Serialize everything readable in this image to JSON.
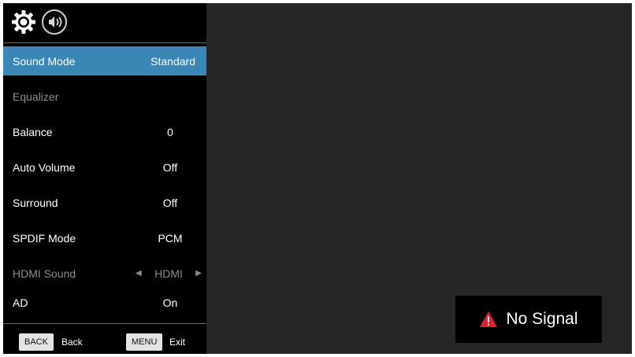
{
  "header": {
    "icons": [
      "gear-icon",
      "speaker-icon"
    ]
  },
  "menu": {
    "items": [
      {
        "label": "Sound Mode",
        "value": "Standard",
        "state": "selected"
      },
      {
        "label": "Equalizer",
        "value": "",
        "state": "disabled"
      },
      {
        "label": "Balance",
        "value": "0",
        "state": "normal"
      },
      {
        "label": "Auto Volume",
        "value": "Off",
        "state": "normal"
      },
      {
        "label": "Surround",
        "value": "Off",
        "state": "normal"
      },
      {
        "label": "SPDIF Mode",
        "value": "PCM",
        "state": "normal"
      },
      {
        "label": "HDMI Sound",
        "value": "HDMI",
        "state": "disabled"
      },
      {
        "label": "AD",
        "value": "On",
        "state": "normal"
      }
    ]
  },
  "footer": {
    "back_key": "BACK",
    "back_label": "Back",
    "menu_key": "MENU",
    "menu_label": "Exit"
  },
  "status": {
    "message": "No Signal",
    "icon": "warning-icon"
  },
  "colors": {
    "selected_row": "#3a86b5",
    "warning": "#e0202a",
    "background": "#272525"
  }
}
